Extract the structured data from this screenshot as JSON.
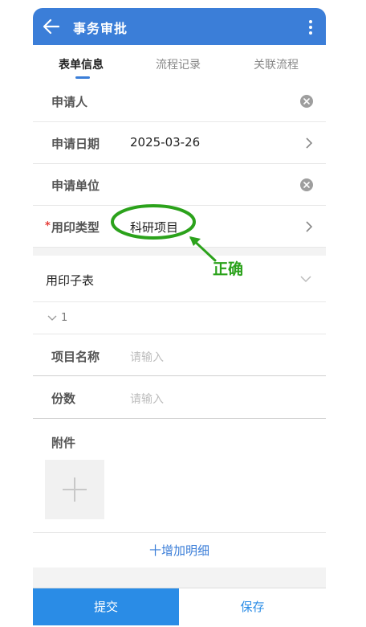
{
  "header": {
    "title": "事务审批"
  },
  "tabs": [
    {
      "label": "表单信息"
    },
    {
      "label": "流程记录"
    },
    {
      "label": "关联流程"
    }
  ],
  "form": {
    "applicant": {
      "label": "申请人",
      "value": ""
    },
    "apply_date": {
      "label": "申请日期",
      "value": "2025-03-26"
    },
    "apply_unit": {
      "label": "申请单位",
      "value": ""
    },
    "seal_type": {
      "label": "用印类型",
      "required_mark": "*",
      "value": "科研项目"
    }
  },
  "subtable": {
    "title": "用印子表",
    "index": "1",
    "project_name": {
      "label": "项目名称",
      "placeholder": "请输入"
    },
    "copies": {
      "label": "份数",
      "placeholder": "请输入"
    },
    "attachment": {
      "label": "附件"
    },
    "add_detail_label": "十增加明细"
  },
  "footer": {
    "submit_label": "提交",
    "save_label": "保存"
  },
  "annotation": {
    "text": "正确",
    "color": "#2ba21b"
  },
  "colors": {
    "primary": "#3b7ed8",
    "submit": "#2a8ce6",
    "required": "#e53935"
  }
}
